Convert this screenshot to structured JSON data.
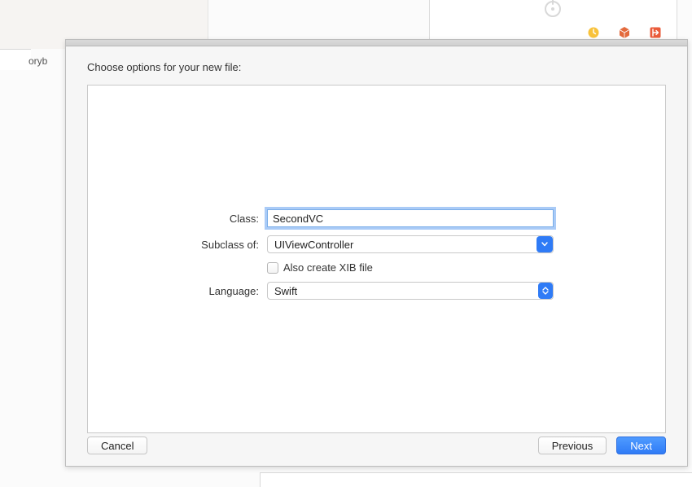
{
  "background": {
    "sidebar_item": "oryb",
    "icons": [
      "clock-icon",
      "box-icon",
      "exit-icon"
    ]
  },
  "sheet": {
    "title": "Choose options for your new file:",
    "form": {
      "class_label": "Class:",
      "class_value": "SecondVC",
      "subclass_label": "Subclass of:",
      "subclass_value": "UIViewController",
      "xib_label": "Also create XIB file",
      "xib_checked": false,
      "language_label": "Language:",
      "language_value": "Swift"
    },
    "buttons": {
      "cancel": "Cancel",
      "previous": "Previous",
      "next": "Next"
    }
  }
}
